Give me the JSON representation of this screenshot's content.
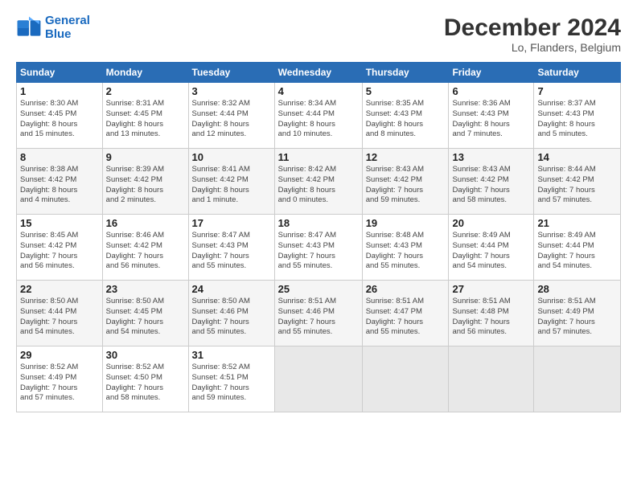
{
  "header": {
    "logo_line1": "General",
    "logo_line2": "Blue",
    "month": "December 2024",
    "location": "Lo, Flanders, Belgium"
  },
  "weekdays": [
    "Sunday",
    "Monday",
    "Tuesday",
    "Wednesday",
    "Thursday",
    "Friday",
    "Saturday"
  ],
  "weeks": [
    [
      {
        "day": "1",
        "info": "Sunrise: 8:30 AM\nSunset: 4:45 PM\nDaylight: 8 hours\nand 15 minutes."
      },
      {
        "day": "2",
        "info": "Sunrise: 8:31 AM\nSunset: 4:45 PM\nDaylight: 8 hours\nand 13 minutes."
      },
      {
        "day": "3",
        "info": "Sunrise: 8:32 AM\nSunset: 4:44 PM\nDaylight: 8 hours\nand 12 minutes."
      },
      {
        "day": "4",
        "info": "Sunrise: 8:34 AM\nSunset: 4:44 PM\nDaylight: 8 hours\nand 10 minutes."
      },
      {
        "day": "5",
        "info": "Sunrise: 8:35 AM\nSunset: 4:43 PM\nDaylight: 8 hours\nand 8 minutes."
      },
      {
        "day": "6",
        "info": "Sunrise: 8:36 AM\nSunset: 4:43 PM\nDaylight: 8 hours\nand 7 minutes."
      },
      {
        "day": "7",
        "info": "Sunrise: 8:37 AM\nSunset: 4:43 PM\nDaylight: 8 hours\nand 5 minutes."
      }
    ],
    [
      {
        "day": "8",
        "info": "Sunrise: 8:38 AM\nSunset: 4:42 PM\nDaylight: 8 hours\nand 4 minutes."
      },
      {
        "day": "9",
        "info": "Sunrise: 8:39 AM\nSunset: 4:42 PM\nDaylight: 8 hours\nand 2 minutes."
      },
      {
        "day": "10",
        "info": "Sunrise: 8:41 AM\nSunset: 4:42 PM\nDaylight: 8 hours\nand 1 minute."
      },
      {
        "day": "11",
        "info": "Sunrise: 8:42 AM\nSunset: 4:42 PM\nDaylight: 8 hours\nand 0 minutes."
      },
      {
        "day": "12",
        "info": "Sunrise: 8:43 AM\nSunset: 4:42 PM\nDaylight: 7 hours\nand 59 minutes."
      },
      {
        "day": "13",
        "info": "Sunrise: 8:43 AM\nSunset: 4:42 PM\nDaylight: 7 hours\nand 58 minutes."
      },
      {
        "day": "14",
        "info": "Sunrise: 8:44 AM\nSunset: 4:42 PM\nDaylight: 7 hours\nand 57 minutes."
      }
    ],
    [
      {
        "day": "15",
        "info": "Sunrise: 8:45 AM\nSunset: 4:42 PM\nDaylight: 7 hours\nand 56 minutes."
      },
      {
        "day": "16",
        "info": "Sunrise: 8:46 AM\nSunset: 4:42 PM\nDaylight: 7 hours\nand 56 minutes."
      },
      {
        "day": "17",
        "info": "Sunrise: 8:47 AM\nSunset: 4:43 PM\nDaylight: 7 hours\nand 55 minutes."
      },
      {
        "day": "18",
        "info": "Sunrise: 8:47 AM\nSunset: 4:43 PM\nDaylight: 7 hours\nand 55 minutes."
      },
      {
        "day": "19",
        "info": "Sunrise: 8:48 AM\nSunset: 4:43 PM\nDaylight: 7 hours\nand 55 minutes."
      },
      {
        "day": "20",
        "info": "Sunrise: 8:49 AM\nSunset: 4:44 PM\nDaylight: 7 hours\nand 54 minutes."
      },
      {
        "day": "21",
        "info": "Sunrise: 8:49 AM\nSunset: 4:44 PM\nDaylight: 7 hours\nand 54 minutes."
      }
    ],
    [
      {
        "day": "22",
        "info": "Sunrise: 8:50 AM\nSunset: 4:44 PM\nDaylight: 7 hours\nand 54 minutes."
      },
      {
        "day": "23",
        "info": "Sunrise: 8:50 AM\nSunset: 4:45 PM\nDaylight: 7 hours\nand 54 minutes."
      },
      {
        "day": "24",
        "info": "Sunrise: 8:50 AM\nSunset: 4:46 PM\nDaylight: 7 hours\nand 55 minutes."
      },
      {
        "day": "25",
        "info": "Sunrise: 8:51 AM\nSunset: 4:46 PM\nDaylight: 7 hours\nand 55 minutes."
      },
      {
        "day": "26",
        "info": "Sunrise: 8:51 AM\nSunset: 4:47 PM\nDaylight: 7 hours\nand 55 minutes."
      },
      {
        "day": "27",
        "info": "Sunrise: 8:51 AM\nSunset: 4:48 PM\nDaylight: 7 hours\nand 56 minutes."
      },
      {
        "day": "28",
        "info": "Sunrise: 8:51 AM\nSunset: 4:49 PM\nDaylight: 7 hours\nand 57 minutes."
      }
    ],
    [
      {
        "day": "29",
        "info": "Sunrise: 8:52 AM\nSunset: 4:49 PM\nDaylight: 7 hours\nand 57 minutes."
      },
      {
        "day": "30",
        "info": "Sunrise: 8:52 AM\nSunset: 4:50 PM\nDaylight: 7 hours\nand 58 minutes."
      },
      {
        "day": "31",
        "info": "Sunrise: 8:52 AM\nSunset: 4:51 PM\nDaylight: 7 hours\nand 59 minutes."
      },
      {
        "day": "",
        "info": ""
      },
      {
        "day": "",
        "info": ""
      },
      {
        "day": "",
        "info": ""
      },
      {
        "day": "",
        "info": ""
      }
    ]
  ]
}
